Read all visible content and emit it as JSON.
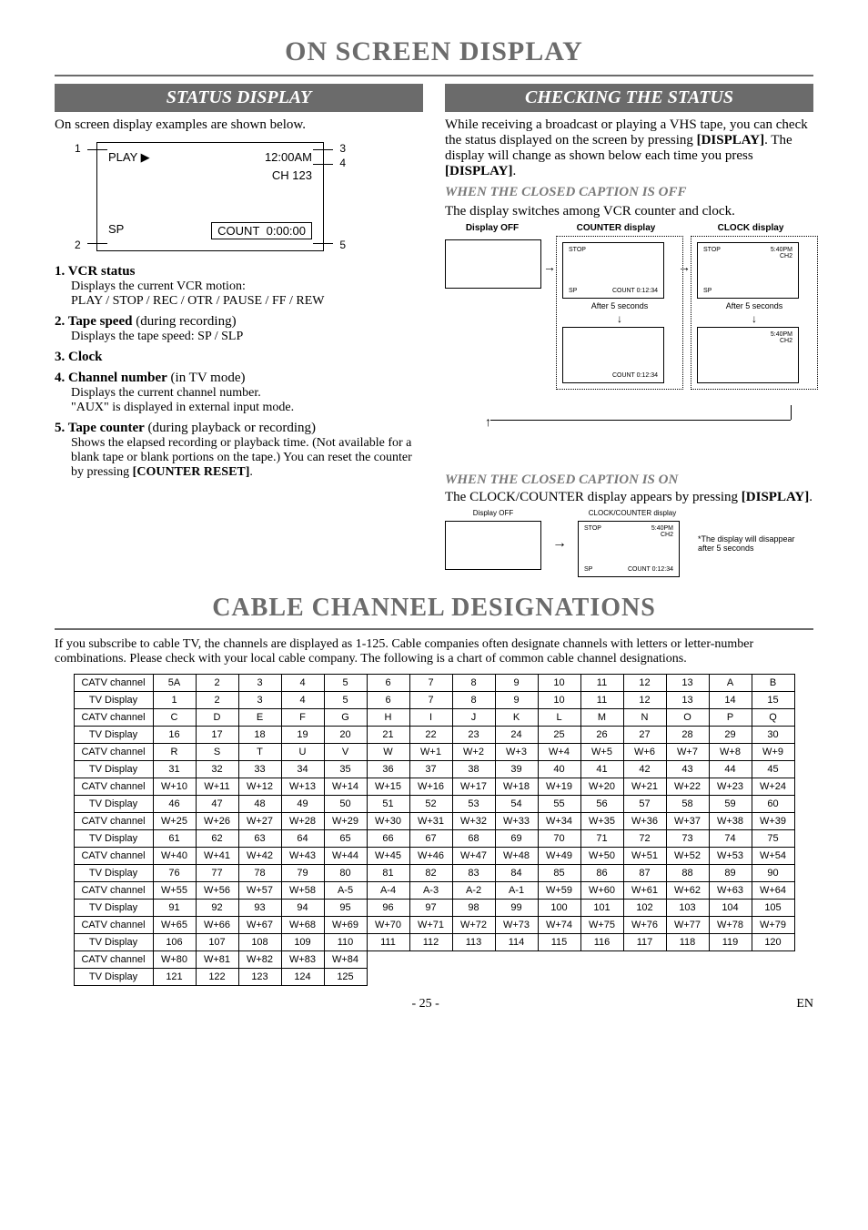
{
  "title_main": "ON SCREEN DISPLAY",
  "section_status": {
    "band": "STATUS DISPLAY",
    "intro": "On screen display examples are shown below.",
    "osd": {
      "play": "PLAY ▶",
      "time": "12:00AM",
      "ch": "CH 123",
      "sp": "SP",
      "count_label": "COUNT",
      "count_val": "0:00:00",
      "n1": "1",
      "n2": "2",
      "n3": "3",
      "n4": "4",
      "n5": "5"
    },
    "items": [
      {
        "hd": "1. VCR status",
        "desc": "Displays the current VCR motion:\nPLAY / STOP / REC / OTR / PAUSE / FF / REW"
      },
      {
        "hd": "2. Tape speed",
        "paren": "(during recording)",
        "desc": "Displays the tape speed: SP / SLP"
      },
      {
        "hd": "3. Clock",
        "desc": ""
      },
      {
        "hd": "4. Channel number",
        "paren": "(in TV mode)",
        "desc": "Displays the current channel number.\n\"AUX\" is displayed in external input mode."
      },
      {
        "hd": "5. Tape counter",
        "paren": "(during playback or recording)",
        "desc": "Shows the elapsed recording or playback time. (Not available for a blank tape or blank portions on the tape.) You can reset the counter by pressing [COUNTER RESET]."
      }
    ]
  },
  "section_check": {
    "band": "CHECKING THE STATUS",
    "p1": "While receiving a broadcast or playing a VHS tape, you can check the status displayed on the screen by pressing [DISPLAY]. The display will change as shown below each time you press [DISPLAY].",
    "cc_off": "WHEN THE CLOSED CAPTION IS OFF",
    "cc_off_text": "The display switches among VCR counter and clock.",
    "hdr_off": "Display OFF",
    "hdr_counter": "COUNTER display",
    "hdr_clock": "CLOCK display",
    "stop": "STOP",
    "sp": "SP",
    "count": "COUNT  0:12:34",
    "time2": "5:40PM",
    "ch2": "CH2",
    "after": "After 5 seconds",
    "cc_on": "WHEN THE CLOSED CAPTION IS ON",
    "cc_on_text": "The CLOCK/COUNTER display appears by pressing [DISPLAY].",
    "hdr_cc": "CLOCK/COUNTER display",
    "note": "*The display will disappear after 5 seconds"
  },
  "section_cable": {
    "title": "CABLE CHANNEL DESIGNATIONS",
    "intro": "If you subscribe to cable TV, the channels are displayed as 1-125. Cable companies often designate channels with letters or letter-number combinations. Please check with your local cable company. The following is a chart of common cable channel designations.",
    "row_labels": {
      "catv": "CATV channel",
      "tv": "TV Display"
    },
    "blocks": [
      {
        "catv": [
          "5A",
          "2",
          "3",
          "4",
          "5",
          "6",
          "7",
          "8",
          "9",
          "10",
          "11",
          "12",
          "13",
          "A",
          "B"
        ],
        "tv": [
          "1",
          "2",
          "3",
          "4",
          "5",
          "6",
          "7",
          "8",
          "9",
          "10",
          "11",
          "12",
          "13",
          "14",
          "15"
        ]
      },
      {
        "catv": [
          "C",
          "D",
          "E",
          "F",
          "G",
          "H",
          "I",
          "J",
          "K",
          "L",
          "M",
          "N",
          "O",
          "P",
          "Q"
        ],
        "tv": [
          "16",
          "17",
          "18",
          "19",
          "20",
          "21",
          "22",
          "23",
          "24",
          "25",
          "26",
          "27",
          "28",
          "29",
          "30"
        ]
      },
      {
        "catv": [
          "R",
          "S",
          "T",
          "U",
          "V",
          "W",
          "W+1",
          "W+2",
          "W+3",
          "W+4",
          "W+5",
          "W+6",
          "W+7",
          "W+8",
          "W+9"
        ],
        "tv": [
          "31",
          "32",
          "33",
          "34",
          "35",
          "36",
          "37",
          "38",
          "39",
          "40",
          "41",
          "42",
          "43",
          "44",
          "45"
        ]
      },
      {
        "catv": [
          "W+10",
          "W+11",
          "W+12",
          "W+13",
          "W+14",
          "W+15",
          "W+16",
          "W+17",
          "W+18",
          "W+19",
          "W+20",
          "W+21",
          "W+22",
          "W+23",
          "W+24"
        ],
        "tv": [
          "46",
          "47",
          "48",
          "49",
          "50",
          "51",
          "52",
          "53",
          "54",
          "55",
          "56",
          "57",
          "58",
          "59",
          "60"
        ]
      },
      {
        "catv": [
          "W+25",
          "W+26",
          "W+27",
          "W+28",
          "W+29",
          "W+30",
          "W+31",
          "W+32",
          "W+33",
          "W+34",
          "W+35",
          "W+36",
          "W+37",
          "W+38",
          "W+39"
        ],
        "tv": [
          "61",
          "62",
          "63",
          "64",
          "65",
          "66",
          "67",
          "68",
          "69",
          "70",
          "71",
          "72",
          "73",
          "74",
          "75"
        ]
      },
      {
        "catv": [
          "W+40",
          "W+41",
          "W+42",
          "W+43",
          "W+44",
          "W+45",
          "W+46",
          "W+47",
          "W+48",
          "W+49",
          "W+50",
          "W+51",
          "W+52",
          "W+53",
          "W+54"
        ],
        "tv": [
          "76",
          "77",
          "78",
          "79",
          "80",
          "81",
          "82",
          "83",
          "84",
          "85",
          "86",
          "87",
          "88",
          "89",
          "90"
        ]
      },
      {
        "catv": [
          "W+55",
          "W+56",
          "W+57",
          "W+58",
          "A-5",
          "A-4",
          "A-3",
          "A-2",
          "A-1",
          "W+59",
          "W+60",
          "W+61",
          "W+62",
          "W+63",
          "W+64"
        ],
        "tv": [
          "91",
          "92",
          "93",
          "94",
          "95",
          "96",
          "97",
          "98",
          "99",
          "100",
          "101",
          "102",
          "103",
          "104",
          "105"
        ]
      },
      {
        "catv": [
          "W+65",
          "W+66",
          "W+67",
          "W+68",
          "W+69",
          "W+70",
          "W+71",
          "W+72",
          "W+73",
          "W+74",
          "W+75",
          "W+76",
          "W+77",
          "W+78",
          "W+79"
        ],
        "tv": [
          "106",
          "107",
          "108",
          "109",
          "110",
          "111",
          "112",
          "113",
          "114",
          "115",
          "116",
          "117",
          "118",
          "119",
          "120"
        ]
      },
      {
        "catv": [
          "W+80",
          "W+81",
          "W+82",
          "W+83",
          "W+84"
        ],
        "tv": [
          "121",
          "122",
          "123",
          "124",
          "125"
        ]
      }
    ]
  },
  "footer": {
    "page": "- 25 -",
    "lang": "EN"
  },
  "chart_data": {
    "type": "table",
    "title": "Cable Channel Designations",
    "xlabel": "",
    "ylabel": "",
    "series": [
      {
        "name": "CATV channel",
        "values": [
          "5A",
          "2",
          "3",
          "4",
          "5",
          "6",
          "7",
          "8",
          "9",
          "10",
          "11",
          "12",
          "13",
          "A",
          "B",
          "C",
          "D",
          "E",
          "F",
          "G",
          "H",
          "I",
          "J",
          "K",
          "L",
          "M",
          "N",
          "O",
          "P",
          "Q",
          "R",
          "S",
          "T",
          "U",
          "V",
          "W",
          "W+1",
          "W+2",
          "W+3",
          "W+4",
          "W+5",
          "W+6",
          "W+7",
          "W+8",
          "W+9",
          "W+10",
          "W+11",
          "W+12",
          "W+13",
          "W+14",
          "W+15",
          "W+16",
          "W+17",
          "W+18",
          "W+19",
          "W+20",
          "W+21",
          "W+22",
          "W+23",
          "W+24",
          "W+25",
          "W+26",
          "W+27",
          "W+28",
          "W+29",
          "W+30",
          "W+31",
          "W+32",
          "W+33",
          "W+34",
          "W+35",
          "W+36",
          "W+37",
          "W+38",
          "W+39",
          "W+40",
          "W+41",
          "W+42",
          "W+43",
          "W+44",
          "W+45",
          "W+46",
          "W+47",
          "W+48",
          "W+49",
          "W+50",
          "W+51",
          "W+52",
          "W+53",
          "W+54",
          "W+55",
          "W+56",
          "W+57",
          "W+58",
          "A-5",
          "A-4",
          "A-3",
          "A-2",
          "A-1",
          "W+59",
          "W+60",
          "W+61",
          "W+62",
          "W+63",
          "W+64",
          "W+65",
          "W+66",
          "W+67",
          "W+68",
          "W+69",
          "W+70",
          "W+71",
          "W+72",
          "W+73",
          "W+74",
          "W+75",
          "W+76",
          "W+77",
          "W+78",
          "W+79",
          "W+80",
          "W+81",
          "W+82",
          "W+83",
          "W+84"
        ]
      },
      {
        "name": "TV Display",
        "values": [
          1,
          2,
          3,
          4,
          5,
          6,
          7,
          8,
          9,
          10,
          11,
          12,
          13,
          14,
          15,
          16,
          17,
          18,
          19,
          20,
          21,
          22,
          23,
          24,
          25,
          26,
          27,
          28,
          29,
          30,
          31,
          32,
          33,
          34,
          35,
          36,
          37,
          38,
          39,
          40,
          41,
          42,
          43,
          44,
          45,
          46,
          47,
          48,
          49,
          50,
          51,
          52,
          53,
          54,
          55,
          56,
          57,
          58,
          59,
          60,
          61,
          62,
          63,
          64,
          65,
          66,
          67,
          68,
          69,
          70,
          71,
          72,
          73,
          74,
          75,
          76,
          77,
          78,
          79,
          80,
          81,
          82,
          83,
          84,
          85,
          86,
          87,
          88,
          89,
          90,
          91,
          92,
          93,
          94,
          95,
          96,
          97,
          98,
          99,
          100,
          101,
          102,
          103,
          104,
          105,
          106,
          107,
          108,
          109,
          110,
          111,
          112,
          113,
          114,
          115,
          116,
          117,
          118,
          119,
          120,
          121,
          122,
          123,
          124,
          125
        ]
      }
    ]
  }
}
